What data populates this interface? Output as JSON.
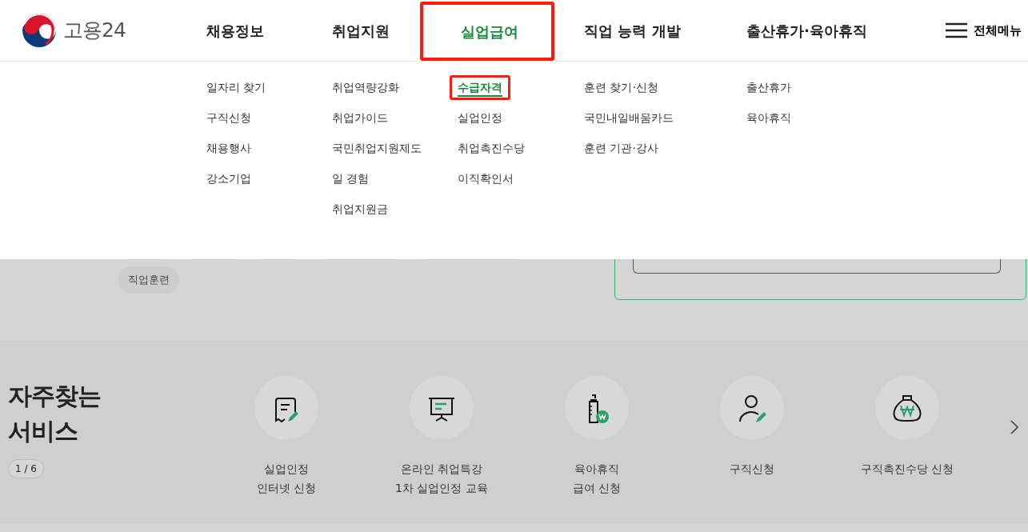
{
  "logo": {
    "text": "고용24"
  },
  "nav": [
    {
      "label": "채용정보",
      "selected": false,
      "highlighted": false,
      "submenu": [
        {
          "label": "일자리 찾기",
          "selected": false,
          "highlighted": false
        },
        {
          "label": "구직신청",
          "selected": false,
          "highlighted": false
        },
        {
          "label": "채용행사",
          "selected": false,
          "highlighted": false
        },
        {
          "label": "강소기업",
          "selected": false,
          "highlighted": false
        }
      ]
    },
    {
      "label": "취업지원",
      "selected": false,
      "highlighted": false,
      "submenu": [
        {
          "label": "취업역량강화",
          "selected": false,
          "highlighted": false
        },
        {
          "label": "취업가이드",
          "selected": false,
          "highlighted": false
        },
        {
          "label": "국민취업지원제도",
          "selected": false,
          "highlighted": false
        },
        {
          "label": "일 경험",
          "selected": false,
          "highlighted": false
        },
        {
          "label": "취업지원금",
          "selected": false,
          "highlighted": false
        }
      ]
    },
    {
      "label": "실업급여",
      "selected": true,
      "highlighted": true,
      "submenu": [
        {
          "label": "수급자격",
          "selected": true,
          "highlighted": true
        },
        {
          "label": "실업인정",
          "selected": false,
          "highlighted": false
        },
        {
          "label": "취업촉진수당",
          "selected": false,
          "highlighted": false
        },
        {
          "label": "이직확인서",
          "selected": false,
          "highlighted": false
        }
      ]
    },
    {
      "label": "직업 능력 개발",
      "selected": false,
      "highlighted": false,
      "submenu": [
        {
          "label": "훈련 찾기·신청",
          "selected": false,
          "highlighted": false
        },
        {
          "label": "국민내일배움카드",
          "selected": false,
          "highlighted": false
        },
        {
          "label": "훈련 기관·강사",
          "selected": false,
          "highlighted": false
        }
      ]
    },
    {
      "label": "출산휴가·육아휴직",
      "selected": false,
      "highlighted": false,
      "submenu": [
        {
          "label": "출산휴가",
          "selected": false,
          "highlighted": false
        },
        {
          "label": "육아휴직",
          "selected": false,
          "highlighted": false
        }
      ]
    }
  ],
  "all_menu": {
    "label": "전체메뉴"
  },
  "tags": [
    {
      "label": "직업훈련"
    }
  ],
  "services": {
    "title": "자주찾는\n서비스",
    "pager": "1 / 6",
    "items": [
      {
        "kind": "document",
        "label": "실업인정\n인터넷 신청"
      },
      {
        "kind": "presentation",
        "label": "온라인 취업특강\n1차 실업인정 교육"
      },
      {
        "kind": "bottle",
        "label": "육아휴직\n급여 신청"
      },
      {
        "kind": "person",
        "label": "구직신청"
      },
      {
        "kind": "moneybag",
        "label": "구직촉진수당 신청"
      }
    ]
  }
}
